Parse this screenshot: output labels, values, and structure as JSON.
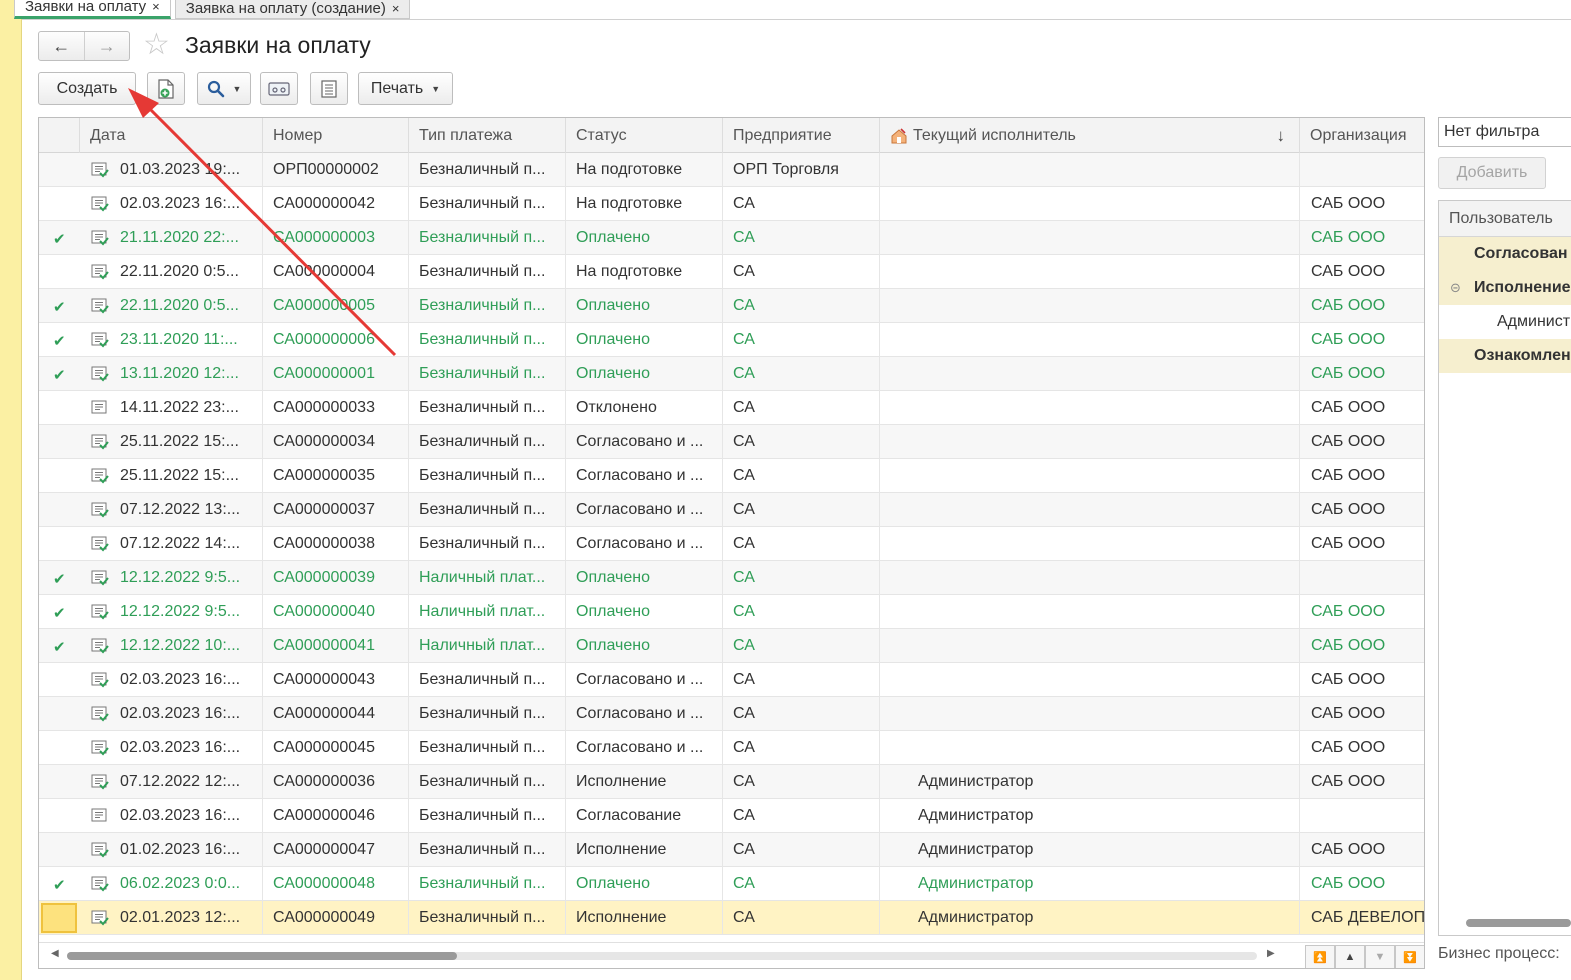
{
  "tabs": [
    {
      "label": "Заявки на оплату",
      "close": "×",
      "active": true
    },
    {
      "label": "Заявка на оплату (создание)",
      "close": "×",
      "active": false
    }
  ],
  "header": {
    "title": "Заявки на оплату",
    "back_icon": "arrow-left-icon",
    "forward_icon": "arrow-right-icon",
    "favorite_icon": "star-icon"
  },
  "toolbar": {
    "create_label": "Создать",
    "print_label": "Печать"
  },
  "table": {
    "columns": [
      "Дата",
      "Номер",
      "Тип платежа",
      "Статус",
      "Предприятие",
      "Текущий исполнитель",
      "Организация"
    ],
    "sort_indicator": "↓",
    "rows": [
      {
        "done": false,
        "green": false,
        "date": "01.03.2023 19:...",
        "num": "ОРП00000002",
        "type": "Безналичный п...",
        "status": "На подготовке",
        "ent": "ОРП Торговля",
        "exec": "",
        "org": ""
      },
      {
        "done": false,
        "green": false,
        "date": "02.03.2023 16:...",
        "num": "СА000000042",
        "type": "Безналичный п...",
        "status": "На подготовке",
        "ent": "СА",
        "exec": "",
        "org": "САБ ООО"
      },
      {
        "done": true,
        "green": true,
        "date": "21.11.2020 22:...",
        "num": "СА000000003",
        "type": "Безналичный п...",
        "status": "Оплачено",
        "ent": "СА",
        "exec": "",
        "org": "САБ ООО"
      },
      {
        "done": false,
        "green": false,
        "date": "22.11.2020 0:5...",
        "num": "СА000000004",
        "type": "Безналичный п...",
        "status": "На подготовке",
        "ent": "СА",
        "exec": "",
        "org": "САБ ООО"
      },
      {
        "done": true,
        "green": true,
        "date": "22.11.2020 0:5...",
        "num": "СА000000005",
        "type": "Безналичный п...",
        "status": "Оплачено",
        "ent": "СА",
        "exec": "",
        "org": "САБ ООО"
      },
      {
        "done": true,
        "green": true,
        "date": "23.11.2020 11:...",
        "num": "СА000000006",
        "type": "Безналичный п...",
        "status": "Оплачено",
        "ent": "СА",
        "exec": "",
        "org": "САБ ООО"
      },
      {
        "done": true,
        "green": true,
        "date": "13.11.2020 12:...",
        "num": "СА000000001",
        "type": "Безналичный п...",
        "status": "Оплачено",
        "ent": "СА",
        "exec": "",
        "org": "САБ ООО"
      },
      {
        "done": false,
        "green": false,
        "plain": true,
        "date": "14.11.2022 23:...",
        "num": "СА000000033",
        "type": "Безналичный п...",
        "status": "Отклонено",
        "ent": "СА",
        "exec": "",
        "org": "САБ ООО"
      },
      {
        "done": false,
        "green": false,
        "date": "25.11.2022 15:...",
        "num": "СА000000034",
        "type": "Безналичный п...",
        "status": "Согласовано и ...",
        "ent": "СА",
        "exec": "",
        "org": "САБ ООО"
      },
      {
        "done": false,
        "green": false,
        "date": "25.11.2022 15:...",
        "num": "СА000000035",
        "type": "Безналичный п...",
        "status": "Согласовано и ...",
        "ent": "СА",
        "exec": "",
        "org": "САБ ООО"
      },
      {
        "done": false,
        "green": false,
        "date": "07.12.2022 13:...",
        "num": "СА000000037",
        "type": "Безналичный п...",
        "status": "Согласовано и ...",
        "ent": "СА",
        "exec": "",
        "org": "САБ ООО"
      },
      {
        "done": false,
        "green": false,
        "date": "07.12.2022 14:...",
        "num": "СА000000038",
        "type": "Безналичный п...",
        "status": "Согласовано и ...",
        "ent": "СА",
        "exec": "",
        "org": "САБ ООО"
      },
      {
        "done": true,
        "green": true,
        "date": "12.12.2022 9:5...",
        "num": "СА000000039",
        "type": "Наличный плат...",
        "status": "Оплачено",
        "ent": "СА",
        "exec": "",
        "org": ""
      },
      {
        "done": true,
        "green": true,
        "date": "12.12.2022 9:5...",
        "num": "СА000000040",
        "type": "Наличный плат...",
        "status": "Оплачено",
        "ent": "СА",
        "exec": "",
        "org": "САБ ООО"
      },
      {
        "done": true,
        "green": true,
        "date": "12.12.2022 10:...",
        "num": "СА000000041",
        "type": "Наличный плат...",
        "status": "Оплачено",
        "ent": "СА",
        "exec": "",
        "org": "САБ ООО"
      },
      {
        "done": false,
        "green": false,
        "date": "02.03.2023 16:...",
        "num": "СА000000043",
        "type": "Безналичный п...",
        "status": "Согласовано и ...",
        "ent": "СА",
        "exec": "",
        "org": "САБ ООО"
      },
      {
        "done": false,
        "green": false,
        "date": "02.03.2023 16:...",
        "num": "СА000000044",
        "type": "Безналичный п...",
        "status": "Согласовано и ...",
        "ent": "СА",
        "exec": "",
        "org": "САБ ООО"
      },
      {
        "done": false,
        "green": false,
        "date": "02.03.2023 16:...",
        "num": "СА000000045",
        "type": "Безналичный п...",
        "status": "Согласовано и ...",
        "ent": "СА",
        "exec": "",
        "org": "САБ ООО"
      },
      {
        "done": false,
        "green": false,
        "date": "07.12.2022 12:...",
        "num": "СА000000036",
        "type": "Безналичный п...",
        "status": "Исполнение",
        "ent": "СА",
        "exec": "Администратор",
        "org": "САБ ООО"
      },
      {
        "done": false,
        "green": false,
        "plain": true,
        "date": "02.03.2023 16:...",
        "num": "СА000000046",
        "type": "Безналичный п...",
        "status": "Согласование",
        "ent": "СА",
        "exec": "Администратор",
        "org": ""
      },
      {
        "done": false,
        "green": false,
        "date": "01.02.2023 16:...",
        "num": "СА000000047",
        "type": "Безналичный п...",
        "status": "Исполнение",
        "ent": "СА",
        "exec": "Администратор",
        "org": "САБ ООО"
      },
      {
        "done": true,
        "green": true,
        "date": "06.02.2023 0:0...",
        "num": "СА000000048",
        "type": "Безналичный п...",
        "status": "Оплачено",
        "ent": "СА",
        "exec": "Администратор",
        "org": "САБ ООО"
      },
      {
        "done": false,
        "green": false,
        "selected": true,
        "date": "02.01.2023 12:...",
        "num": "СА000000049",
        "type": "Безналичный п...",
        "status": "Исполнение",
        "ent": "СА",
        "exec": "Администратор",
        "org": "САБ ДЕВЕЛОП"
      }
    ]
  },
  "right_panel": {
    "filter_value": "Нет фильтра",
    "add_label": "Добавить",
    "header": "Пользователь",
    "rows": [
      {
        "label": "Согласован",
        "kind": "group"
      },
      {
        "label": "Исполнение",
        "kind": "group-open"
      },
      {
        "label": "Админист",
        "kind": "item"
      },
      {
        "label": "Ознакомлен",
        "kind": "group"
      }
    ],
    "bp_label": "Бизнес процесс:"
  },
  "colors": {
    "green": "#2f9e57",
    "selection": "#fff3c4",
    "annotation_arrow": "#e53935"
  }
}
